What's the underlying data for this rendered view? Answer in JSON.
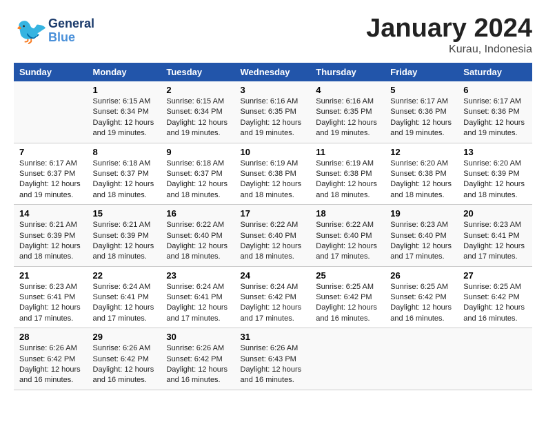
{
  "header": {
    "logo_general": "General",
    "logo_blue": "Blue",
    "month": "January 2024",
    "location": "Kurau, Indonesia"
  },
  "weekdays": [
    "Sunday",
    "Monday",
    "Tuesday",
    "Wednesday",
    "Thursday",
    "Friday",
    "Saturday"
  ],
  "weeks": [
    [
      {
        "day": "",
        "info": ""
      },
      {
        "day": "1",
        "info": "Sunrise: 6:15 AM\nSunset: 6:34 PM\nDaylight: 12 hours\nand 19 minutes."
      },
      {
        "day": "2",
        "info": "Sunrise: 6:15 AM\nSunset: 6:34 PM\nDaylight: 12 hours\nand 19 minutes."
      },
      {
        "day": "3",
        "info": "Sunrise: 6:16 AM\nSunset: 6:35 PM\nDaylight: 12 hours\nand 19 minutes."
      },
      {
        "day": "4",
        "info": "Sunrise: 6:16 AM\nSunset: 6:35 PM\nDaylight: 12 hours\nand 19 minutes."
      },
      {
        "day": "5",
        "info": "Sunrise: 6:17 AM\nSunset: 6:36 PM\nDaylight: 12 hours\nand 19 minutes."
      },
      {
        "day": "6",
        "info": "Sunrise: 6:17 AM\nSunset: 6:36 PM\nDaylight: 12 hours\nand 19 minutes."
      }
    ],
    [
      {
        "day": "7",
        "info": "Sunrise: 6:17 AM\nSunset: 6:37 PM\nDaylight: 12 hours\nand 19 minutes."
      },
      {
        "day": "8",
        "info": "Sunrise: 6:18 AM\nSunset: 6:37 PM\nDaylight: 12 hours\nand 18 minutes."
      },
      {
        "day": "9",
        "info": "Sunrise: 6:18 AM\nSunset: 6:37 PM\nDaylight: 12 hours\nand 18 minutes."
      },
      {
        "day": "10",
        "info": "Sunrise: 6:19 AM\nSunset: 6:38 PM\nDaylight: 12 hours\nand 18 minutes."
      },
      {
        "day": "11",
        "info": "Sunrise: 6:19 AM\nSunset: 6:38 PM\nDaylight: 12 hours\nand 18 minutes."
      },
      {
        "day": "12",
        "info": "Sunrise: 6:20 AM\nSunset: 6:38 PM\nDaylight: 12 hours\nand 18 minutes."
      },
      {
        "day": "13",
        "info": "Sunrise: 6:20 AM\nSunset: 6:39 PM\nDaylight: 12 hours\nand 18 minutes."
      }
    ],
    [
      {
        "day": "14",
        "info": "Sunrise: 6:21 AM\nSunset: 6:39 PM\nDaylight: 12 hours\nand 18 minutes."
      },
      {
        "day": "15",
        "info": "Sunrise: 6:21 AM\nSunset: 6:39 PM\nDaylight: 12 hours\nand 18 minutes."
      },
      {
        "day": "16",
        "info": "Sunrise: 6:22 AM\nSunset: 6:40 PM\nDaylight: 12 hours\nand 18 minutes."
      },
      {
        "day": "17",
        "info": "Sunrise: 6:22 AM\nSunset: 6:40 PM\nDaylight: 12 hours\nand 18 minutes."
      },
      {
        "day": "18",
        "info": "Sunrise: 6:22 AM\nSunset: 6:40 PM\nDaylight: 12 hours\nand 17 minutes."
      },
      {
        "day": "19",
        "info": "Sunrise: 6:23 AM\nSunset: 6:40 PM\nDaylight: 12 hours\nand 17 minutes."
      },
      {
        "day": "20",
        "info": "Sunrise: 6:23 AM\nSunset: 6:41 PM\nDaylight: 12 hours\nand 17 minutes."
      }
    ],
    [
      {
        "day": "21",
        "info": "Sunrise: 6:23 AM\nSunset: 6:41 PM\nDaylight: 12 hours\nand 17 minutes."
      },
      {
        "day": "22",
        "info": "Sunrise: 6:24 AM\nSunset: 6:41 PM\nDaylight: 12 hours\nand 17 minutes."
      },
      {
        "day": "23",
        "info": "Sunrise: 6:24 AM\nSunset: 6:41 PM\nDaylight: 12 hours\nand 17 minutes."
      },
      {
        "day": "24",
        "info": "Sunrise: 6:24 AM\nSunset: 6:42 PM\nDaylight: 12 hours\nand 17 minutes."
      },
      {
        "day": "25",
        "info": "Sunrise: 6:25 AM\nSunset: 6:42 PM\nDaylight: 12 hours\nand 16 minutes."
      },
      {
        "day": "26",
        "info": "Sunrise: 6:25 AM\nSunset: 6:42 PM\nDaylight: 12 hours\nand 16 minutes."
      },
      {
        "day": "27",
        "info": "Sunrise: 6:25 AM\nSunset: 6:42 PM\nDaylight: 12 hours\nand 16 minutes."
      }
    ],
    [
      {
        "day": "28",
        "info": "Sunrise: 6:26 AM\nSunset: 6:42 PM\nDaylight: 12 hours\nand 16 minutes."
      },
      {
        "day": "29",
        "info": "Sunrise: 6:26 AM\nSunset: 6:42 PM\nDaylight: 12 hours\nand 16 minutes."
      },
      {
        "day": "30",
        "info": "Sunrise: 6:26 AM\nSunset: 6:42 PM\nDaylight: 12 hours\nand 16 minutes."
      },
      {
        "day": "31",
        "info": "Sunrise: 6:26 AM\nSunset: 6:43 PM\nDaylight: 12 hours\nand 16 minutes."
      },
      {
        "day": "",
        "info": ""
      },
      {
        "day": "",
        "info": ""
      },
      {
        "day": "",
        "info": ""
      }
    ]
  ]
}
